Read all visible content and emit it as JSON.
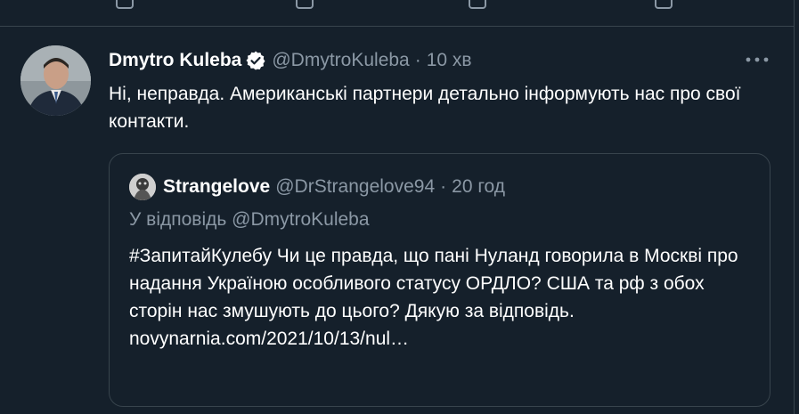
{
  "tweet": {
    "author_name": "Dmytro Kuleba",
    "author_handle": "@DmytroKuleba",
    "separator": "·",
    "time": "10 хв",
    "text": "Ні, неправда. Американські партнери детально інформують нас про свої контакти."
  },
  "quoted": {
    "author_name": "Strangelove",
    "author_handle": "@DrStrangelove94",
    "separator": "·",
    "time": "20 год",
    "reply_prefix": "У відповідь",
    "reply_mention": "@DmytroKuleba",
    "text": "#ЗапитайКулебу Чи це правда, що пані Нуланд говорила в Москві про надання Україною особливого статусу ОРДЛО? США та рф з обох сторін нас змушують до цього? Дякую за відповідь.",
    "link": "novynarnia.com/2021/10/13/nul…"
  },
  "colors": {
    "background": "#15202b",
    "border": "#38444d",
    "secondary_text": "#8b98a5",
    "verified": "#ffffff"
  },
  "icons": {
    "verified": "verified-badge-icon",
    "more": "more-horizontal-icon"
  }
}
